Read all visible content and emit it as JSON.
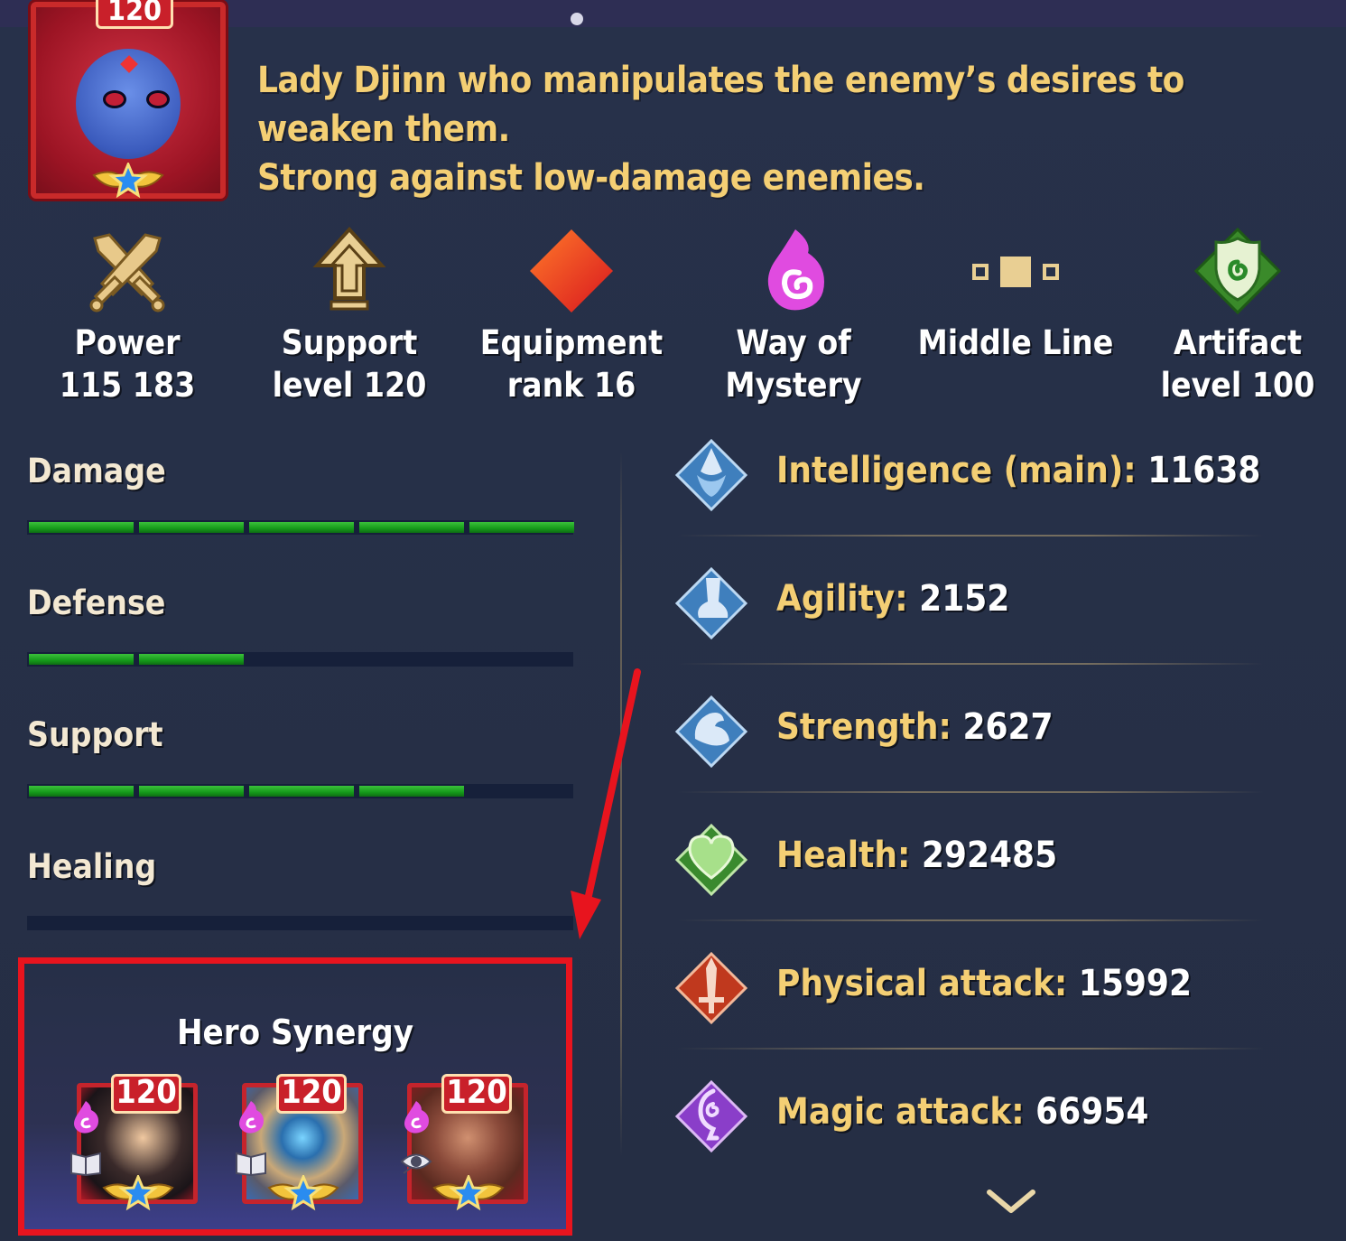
{
  "hero": {
    "level": "120",
    "description": "Lady Djinn who manipulates the enemy’s desires to weaken them.\nStrong against low-damage enemies."
  },
  "summary": [
    {
      "icon": "crossed-swords-icon",
      "label": "Power\n115 183"
    },
    {
      "icon": "support-arrow-icon",
      "label": "Support\nlevel 120"
    },
    {
      "icon": "equipment-rank-diamond-icon",
      "label": "Equipment\nrank 16"
    },
    {
      "icon": "way-of-mystery-flame-icon",
      "label": "Way of\nMystery"
    },
    {
      "icon": "middle-line-icon",
      "label": "Middle Line"
    },
    {
      "icon": "artifact-shield-icon",
      "label": "Artifact\nlevel 100"
    }
  ],
  "stat_bars": [
    {
      "label": "Damage",
      "filled_segments": 5,
      "total_segments": 5
    },
    {
      "label": "Defense",
      "filled_segments": 2,
      "total_segments": 5
    },
    {
      "label": "Support",
      "filled_segments": 4,
      "total_segments": 5
    },
    {
      "label": "Healing",
      "filled_segments": 0,
      "total_segments": 5
    }
  ],
  "attributes": [
    {
      "icon": "intelligence-icon",
      "name": "Intelligence (main): ",
      "value": "11638",
      "color": "#4b8fd0"
    },
    {
      "icon": "agility-icon",
      "name": "Agility: ",
      "value": "2152",
      "color": "#4b8fd0"
    },
    {
      "icon": "strength-icon",
      "name": "Strength: ",
      "value": "2627",
      "color": "#4b8fd0"
    },
    {
      "icon": "health-heart-icon",
      "name": "Health: ",
      "value": "292485",
      "color": "#3a9a2e"
    },
    {
      "icon": "physical-attack-sword-icon",
      "name": "Physical attack: ",
      "value": "15992",
      "color": "#c0391e"
    },
    {
      "icon": "magic-attack-icon",
      "name": "Magic attack: ",
      "value": "66954",
      "color": "#8a3ec9"
    }
  ],
  "synergy": {
    "title": "Hero Synergy",
    "heroes": [
      {
        "level": "120",
        "role": "book-icon"
      },
      {
        "level": "120",
        "role": "book-icon"
      },
      {
        "level": "120",
        "role": "eye-icon"
      }
    ]
  },
  "colors": {
    "accent_gold": "#f4cf74",
    "bar_green": "#1fa122",
    "highlight_red": "#e8141e"
  }
}
